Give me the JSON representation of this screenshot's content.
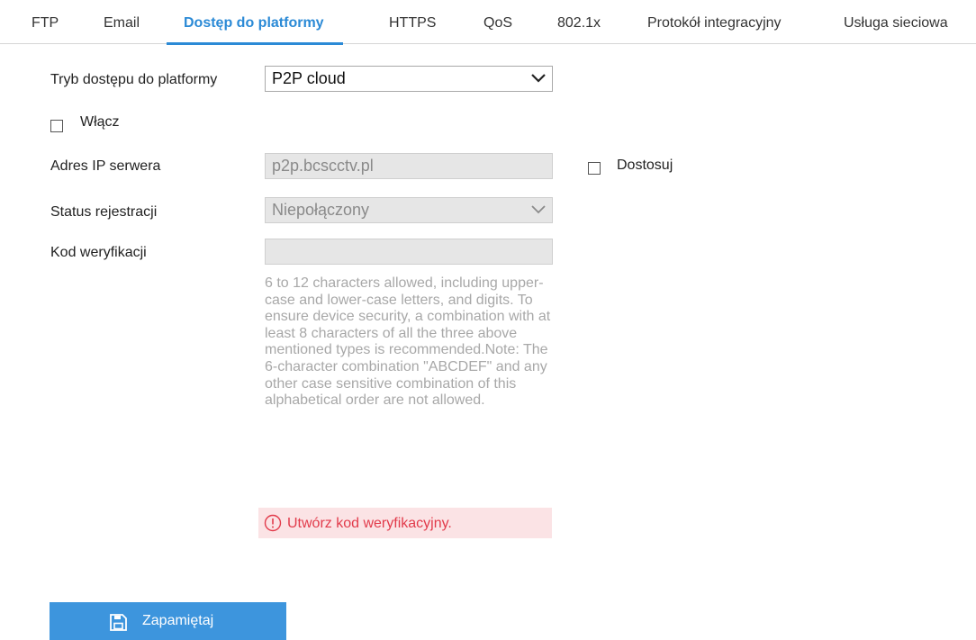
{
  "tabs": [
    {
      "label": "FTP"
    },
    {
      "label": "Email"
    },
    {
      "label": "Dostęp do platformy"
    },
    {
      "label": "HTTPS"
    },
    {
      "label": "QoS"
    },
    {
      "label": "802.1x"
    },
    {
      "label": "Protokół integracyjny"
    },
    {
      "label": "Usługa sieciowa"
    }
  ],
  "active_tab": "Dostęp do platformy",
  "form": {
    "mode_label": "Tryb dostępu do platformy",
    "mode_value": "P2P cloud",
    "enable_label": "Włącz",
    "enable_checked": false,
    "server_ip_label": "Adres IP serwera",
    "server_ip_value": "p2p.bcscctv.pl",
    "customize_label": "Dostosuj",
    "customize_checked": false,
    "reg_status_label": "Status rejestracji",
    "reg_status_value": "Niepołączony",
    "verify_code_label": "Kod weryfikacji",
    "verify_code_value": "",
    "hint": "6 to 12 characters allowed, including upper-case and lower-case letters, and digits. To ensure device security, a combination with at least 8 characters of all the three above mentioned types is recommended.Note: The 6-character combination \"ABCDEF\" and any other case sensitive combination of this alphabetical order are not allowed.",
    "error": "Utwórz kod weryfikacyjny."
  },
  "save_button": {
    "label": "Zapamiętaj",
    "icon": "save-icon"
  },
  "colors": {
    "accent": "#2b8ad6",
    "button": "#3d95dd",
    "error_text": "#e23b4b",
    "error_bg": "#fbe3e5"
  }
}
